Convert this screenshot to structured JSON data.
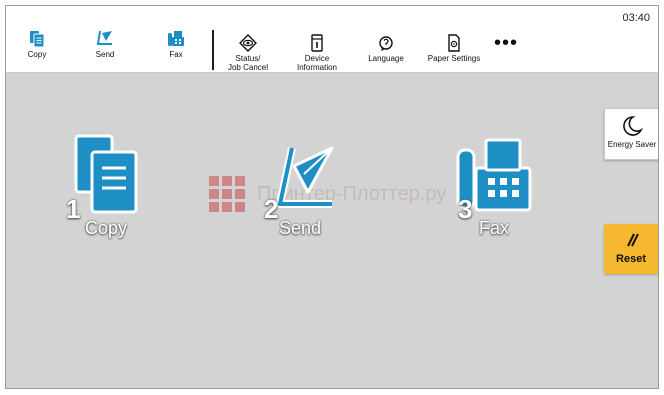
{
  "status_bar": {
    "clock": "03:40"
  },
  "toolbar": {
    "copy": "Copy",
    "send": "Send",
    "fax": "Fax",
    "status_job_cancel": "Status/\nJob Cancel",
    "device_information": "Device\nInformation",
    "language": "Language",
    "paper_settings": "Paper Settings",
    "more": "•••"
  },
  "tiles": {
    "copy": {
      "number": "1",
      "label": "Copy"
    },
    "send": {
      "number": "2",
      "label": "Send"
    },
    "fax": {
      "number": "3",
      "label": "Fax"
    }
  },
  "side_buttons": {
    "energy_saver": "Energy Saver",
    "reset": "Reset"
  },
  "watermark": "Принтер-Плоттер.ру",
  "colors": {
    "accent_blue": "#1e8fc4",
    "reset_yellow": "#f5b82e",
    "background": "#d3d3d3"
  }
}
